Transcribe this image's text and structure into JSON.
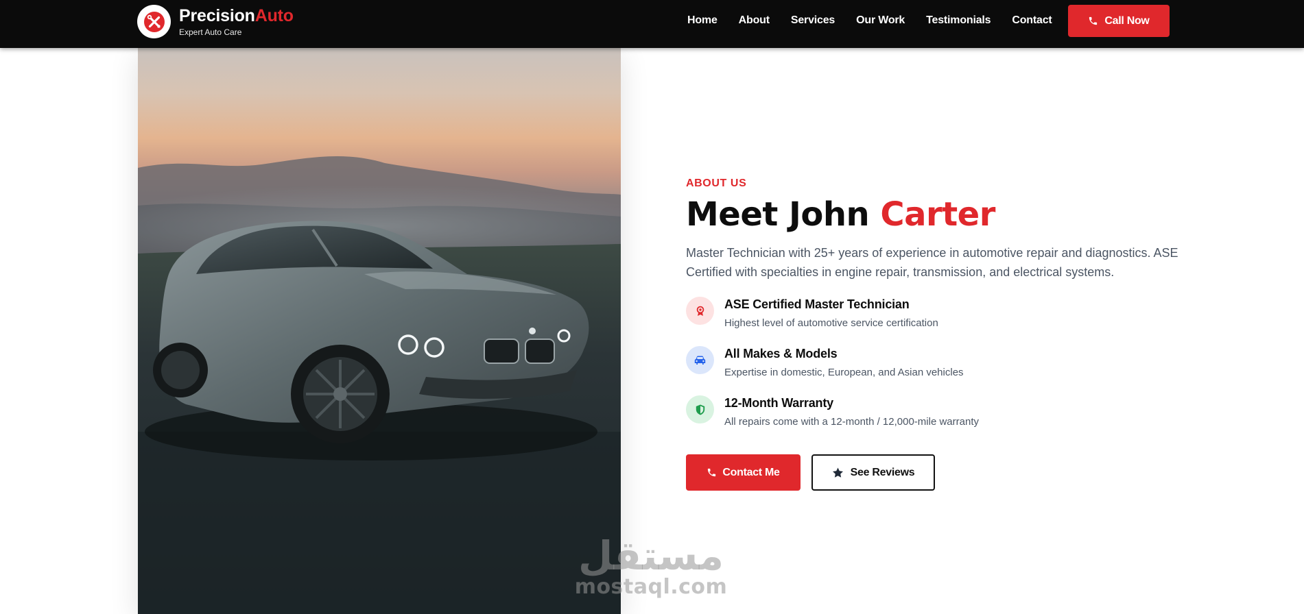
{
  "header": {
    "brand_primary": "Precision",
    "brand_accent": "Auto",
    "tagline": "Expert Auto Care",
    "logo_icon": "tools-icon",
    "nav": [
      {
        "label": "Home"
      },
      {
        "label": "About"
      },
      {
        "label": "Services"
      },
      {
        "label": "Our Work"
      },
      {
        "label": "Testimonials"
      },
      {
        "label": "Contact"
      }
    ],
    "cta_label": "Call Now",
    "cta_icon": "phone-icon"
  },
  "about": {
    "eyebrow": "ABOUT US",
    "title_part1": "Meet John ",
    "title_accent": "Carter",
    "description": "Master Technician with 25+ years of experience in automotive repair and diagnostics. ASE Certified with specialties in engine repair, transmission, and electrical systems.",
    "features": [
      {
        "title": "ASE Certified Master Technician",
        "subtitle": "Highest level of automotive service certification",
        "icon": "award-icon"
      },
      {
        "title": "All Makes & Models",
        "subtitle": "Expertise in domestic, European, and Asian vehicles",
        "icon": "car-icon"
      },
      {
        "title": "12-Month Warranty",
        "subtitle": "All repairs come with a 12-month / 12,000-mile warranty",
        "icon": "shield-icon"
      }
    ],
    "primary_button": "Contact Me",
    "secondary_button": "See Reviews"
  },
  "image": {
    "icon": "sports-car-photo"
  },
  "watermark": {
    "arabic": "مستقل",
    "latin": "mostaql.com"
  },
  "colors": {
    "accent": "#e0282c",
    "header_bg": "#0b0b0b",
    "text_dark": "#0d0d0d",
    "text_muted": "#4b5563"
  }
}
